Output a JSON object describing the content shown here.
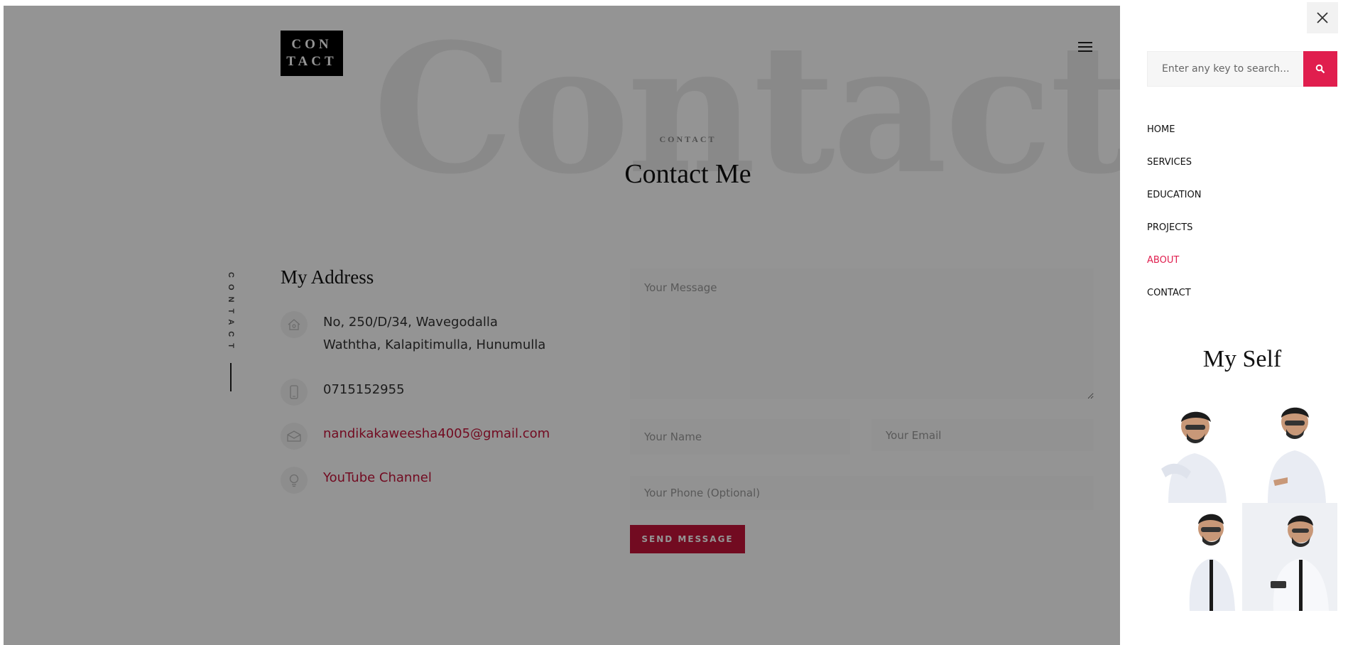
{
  "background_word": "Contact",
  "logo": {
    "line1": "CON",
    "line2": "TACT"
  },
  "section": {
    "label": "CONTACT",
    "title": "Contact Me"
  },
  "side_vertical_label": "CONTACT",
  "address": {
    "title": "My Address",
    "street_line1": "No, 250/D/34, Wavegodalla",
    "street_line2": "Waththa, Kalapitimulla, Hunumulla",
    "phone": "0715152955",
    "email": "nandikakaweesha4005@gmail.com",
    "youtube": "YouTube Channel"
  },
  "form": {
    "message_placeholder": "Your Message",
    "name_placeholder": "Your Name",
    "email_placeholder": "Your Email",
    "phone_placeholder": "Your Phone (Optional)",
    "send_label": "SEND MESSAGE"
  },
  "side_panel": {
    "search_placeholder": "Enter any key to search...",
    "nav": [
      "HOME",
      "SERVICES",
      "EDUCATION",
      "PROJECTS",
      "ABOUT",
      "CONTACT"
    ],
    "active_nav": "ABOUT",
    "myself_title": "My Self"
  },
  "colors": {
    "accent": "#e01e4e",
    "button": "#c4143a",
    "overlay": "rgba(0,0,0,0.42)"
  },
  "icons": [
    "menu-icon",
    "home-icon",
    "phone-icon",
    "mail-icon",
    "bulb-icon",
    "close-icon",
    "search-icon"
  ]
}
